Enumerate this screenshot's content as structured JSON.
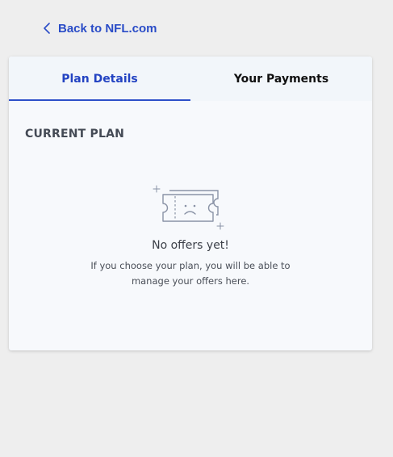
{
  "nav": {
    "back_label": "Back to NFL.com"
  },
  "tabs": [
    {
      "label": "Plan Details",
      "active": true
    },
    {
      "label": "Your Payments",
      "active": false
    }
  ],
  "current_plan": {
    "title": "CURRENT PLAN",
    "empty_icon": "sad-ticket-icon",
    "empty_title": "No offers yet!",
    "empty_description": "If you choose your plan, you will be able to manage your offers here."
  },
  "colors": {
    "accent": "#2a4cc7",
    "background": "#eeeeee",
    "card": "#f7f9fc"
  }
}
